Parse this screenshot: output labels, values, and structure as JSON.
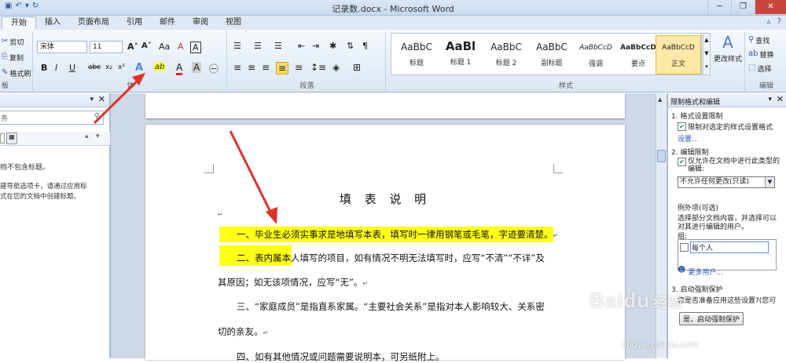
{
  "window": {
    "title": "记录数.docx - Microsoft Word",
    "min": "─",
    "max": "❐",
    "close": "✕"
  },
  "qat": {
    "save": "▣",
    "undo": "↶",
    "undo_count": "▾",
    "redo": "↻"
  },
  "tabs": [
    "开始",
    "插入",
    "页面布局",
    "引用",
    "邮件",
    "审阅",
    "视图"
  ],
  "tab_right": {
    "help": "?",
    "chev": "▵"
  },
  "clipboard": {
    "cut": "剪切",
    "copy": "复制",
    "format_painter": "格式刷",
    "label": "板"
  },
  "font": {
    "name": "宋体",
    "size": "11",
    "grow": "A˄",
    "shrink": "A˅",
    "case": "Aa",
    "clear": "A",
    "bold": "B",
    "italic": "I",
    "underline": "U",
    "strike": "abc",
    "sub": "x₂",
    "sup": "x²",
    "effects": "A",
    "highlight": "ab",
    "color": "A",
    "charshade": "A",
    "charborder": "A",
    "label": "体"
  },
  "paragraph": {
    "label": "段落"
  },
  "styles": {
    "items": [
      {
        "preview": "AaBbC",
        "name": "标题"
      },
      {
        "preview": "AaBl",
        "name": "标题 1"
      },
      {
        "preview": "AaBbC",
        "name": "标题 2"
      },
      {
        "preview": "AaBbC",
        "name": "副标题"
      },
      {
        "preview": "AaBbCcD",
        "name": "强调"
      },
      {
        "preview": "AaBbCcD",
        "name": "要点"
      },
      {
        "preview": "AaBbCcD",
        "name": "正文"
      }
    ],
    "change": "更改样式",
    "label": "样式"
  },
  "editing": {
    "find": "查找",
    "replace": "替换",
    "select": "选择",
    "label": "编辑"
  },
  "nav": {
    "search_placeholder": "",
    "empty1": "档不包含标题。",
    "empty2": "建导航选项卡，请通过应用标",
    "empty3": "式在您的文档中创建标题。"
  },
  "document": {
    "title": "填 表 说 明",
    "p1": "一、毕业生必须实事求是地填写本表，填写时一律用钢笔或毛笔，字迹要清楚。",
    "p2a": "二、表内属本",
    "p2b": "人填写的项目，如有情况不明无法填写时，应写“不清”“不详”及",
    "p2c": "其原因；如无该项情况，应写“无”。",
    "p3a": "三、“家庭成员”是指直系家属。“主要社会关系”是指对本人影响较大、关系密",
    "p3b": "切的亲友。",
    "p4": "四、如有其他情况或问题需要说明本，可另纸附上。"
  },
  "restrict": {
    "header": "限制格式和编辑",
    "s1": "1. 格式设置限制",
    "s1_check": "限制对选定的样式设置格式",
    "s1_link": "设置...",
    "s2": "2. 编辑限制",
    "s2_check": "仅允许在文档中进行此类型的编辑:",
    "s2_select": "不允许任何更改(只读)",
    "exceptions": "例外项(可选)",
    "exc_desc1": "选择部分文档内容，并选择可以",
    "exc_desc2": "对其进行编辑的用户。",
    "group": "组:",
    "everyone": "每个人",
    "more_users": "更多用户...",
    "s3": "3. 启动强制保护",
    "s3_q": "您是否准备应用这些设置?(您可",
    "s3_btn": "是，启动强制保护"
  },
  "watermark": {
    "brand": "Baidu",
    "sub": "经验",
    "url": "jingyan.baidu.com"
  }
}
